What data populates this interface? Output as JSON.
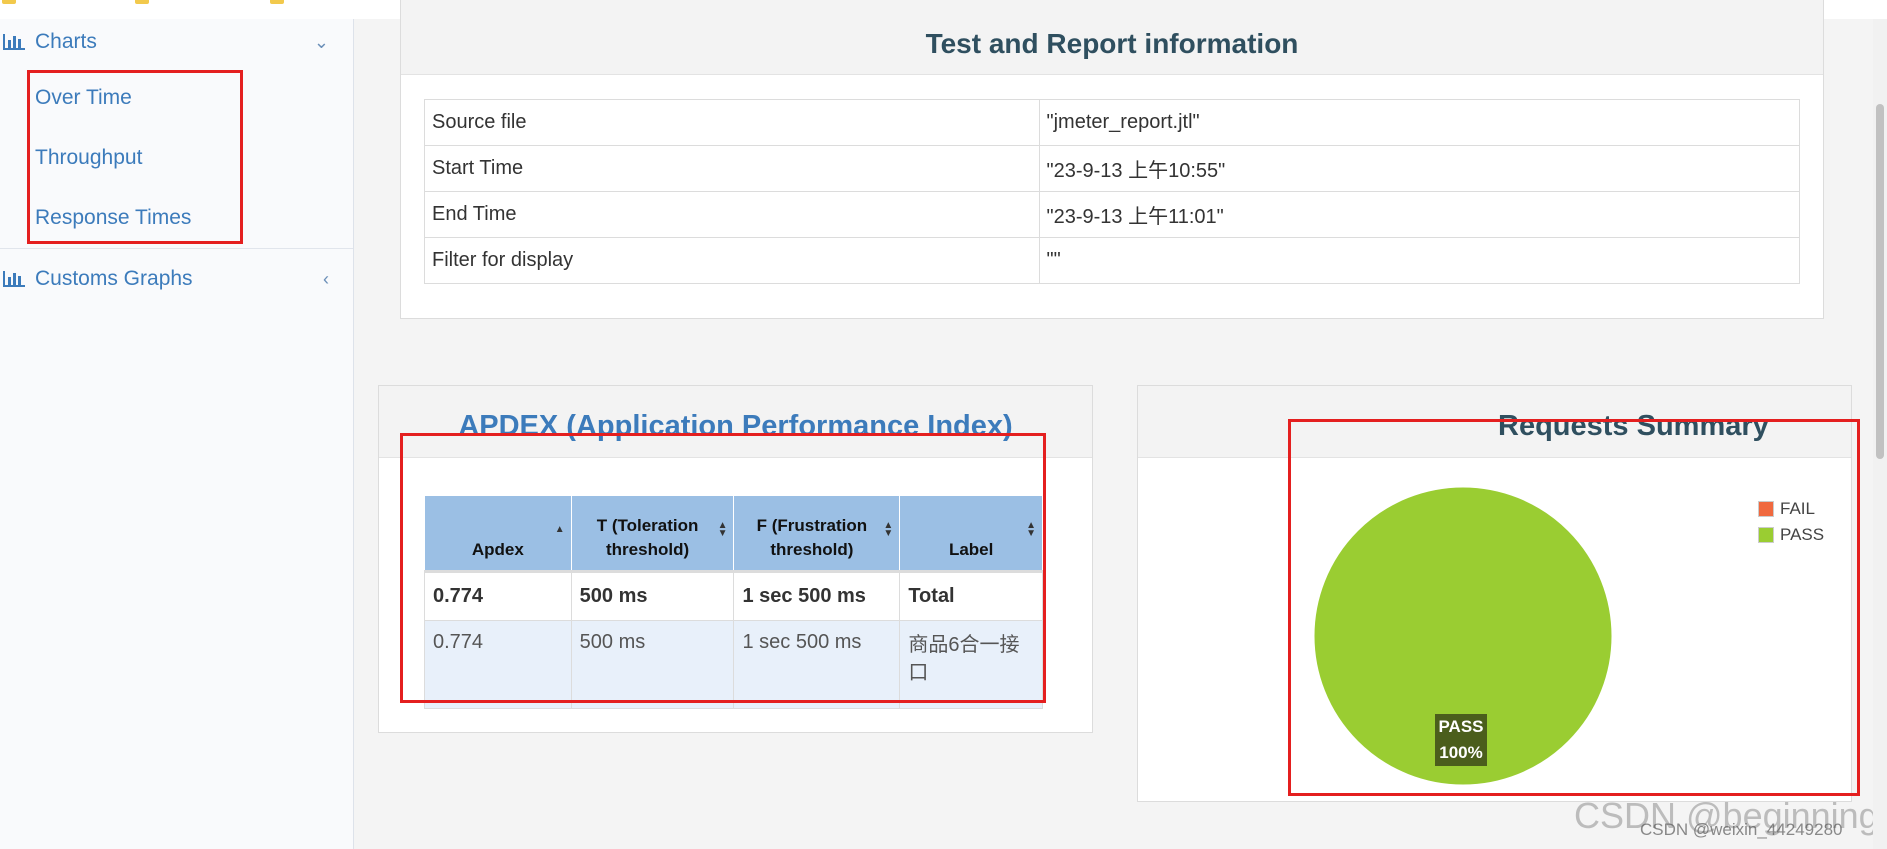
{
  "sidebar": {
    "charts_label": "Charts",
    "charts_items": [
      "Over Time",
      "Throughput",
      "Response Times"
    ],
    "customs_label": "Customs Graphs"
  },
  "info": {
    "title": "Test and Report information",
    "rows": [
      {
        "key": "Source file",
        "value": "\"jmeter_report.jtl\""
      },
      {
        "key": "Start Time",
        "value": "\"23-9-13 上午10:55\""
      },
      {
        "key": "End Time",
        "value": "\"23-9-13 上午11:01\""
      },
      {
        "key": "Filter for display",
        "value": "\"\""
      }
    ]
  },
  "apdex": {
    "title": "APDEX (Application Performance Index)",
    "headers": [
      "Apdex",
      "T (Toleration threshold)",
      "F (Frustration threshold)",
      "Label"
    ],
    "total_row": [
      "0.774",
      "500 ms",
      "1 sec 500 ms",
      "Total"
    ],
    "data_row": [
      "0.774",
      "500 ms",
      "1 sec 500 ms",
      "商品6合一接口"
    ]
  },
  "requests_summary": {
    "title": "Requests Summary",
    "legend": [
      {
        "name": "FAIL",
        "color": "#f0693f"
      },
      {
        "name": "PASS",
        "color": "#9acd32"
      }
    ],
    "slice_label": "PASS",
    "slice_percent": "100%",
    "pass_fraction": 1.0
  },
  "watermark": "CSDN @weixin_44249280",
  "watermark_big": "CSDN @beginningL",
  "colors": {
    "link": "#3c7bbb",
    "panel_title": "#2f4f5f",
    "apdex_title": "#3c7bbb",
    "highlight": "#e41f1f"
  }
}
